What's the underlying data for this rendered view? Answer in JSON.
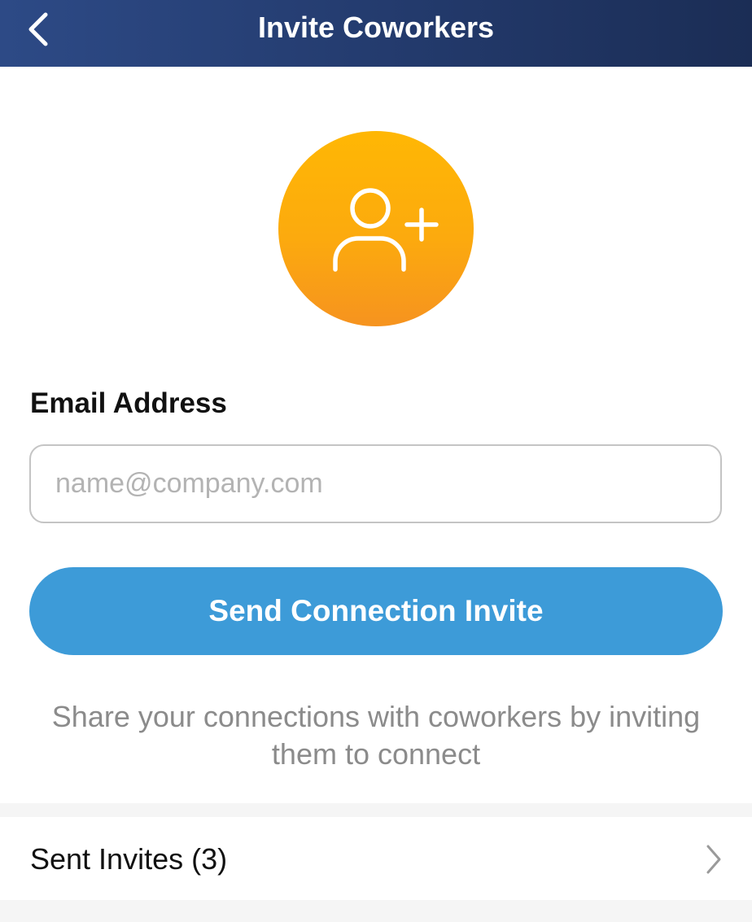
{
  "header": {
    "title": "Invite Coworkers",
    "back_icon": "chevron-left-icon",
    "background": "#233a6c"
  },
  "avatar": {
    "icon": "add-user-icon",
    "color": "#fcaa0e"
  },
  "form": {
    "email_label": "Email Address",
    "email_placeholder": "name@company.com",
    "email_value": ""
  },
  "send_button": {
    "label": "Send Connection Invite",
    "color": "#3d9bd8"
  },
  "helper_text": "Share your connections with coworkers by inviting them to connect",
  "sent_invites": {
    "label": "Sent Invites (3)",
    "icon": "chevron-right-icon"
  }
}
